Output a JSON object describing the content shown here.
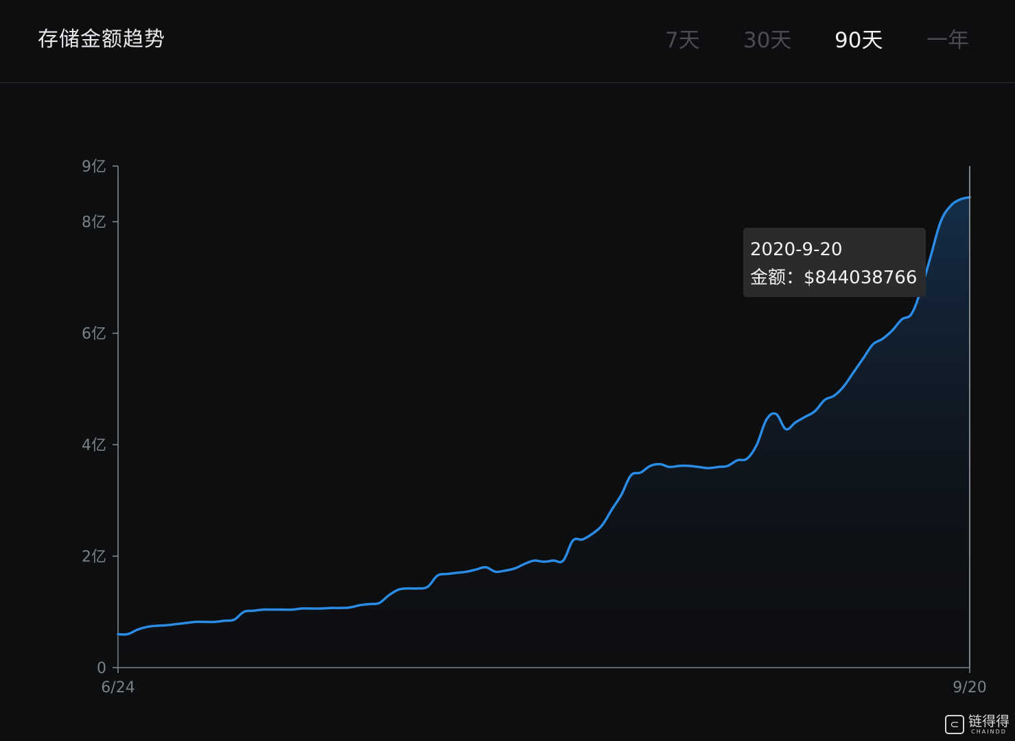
{
  "header": {
    "title": "存储金额趋势",
    "tabs": [
      {
        "label": "7天",
        "active": false
      },
      {
        "label": "30天",
        "active": false
      },
      {
        "label": "90天",
        "active": true
      },
      {
        "label": "一年",
        "active": false
      }
    ]
  },
  "tooltip": {
    "date": "2020-9-20",
    "amount_label": "金额：$844038766"
  },
  "watermark": {
    "logo_glyph": "⊂",
    "cn": "链得得",
    "en": "CHAINDD"
  },
  "colors": {
    "line": "#2b8ce6",
    "area_top": "#163352",
    "background": "#0d0e10",
    "axis": "#8a8d93"
  },
  "chart_data": {
    "type": "area",
    "title": "存储金额趋势",
    "xlabel": "",
    "ylabel": "",
    "x_range": [
      "6/24",
      "9/20"
    ],
    "x_tick_labels": [
      "6/24",
      "9/20"
    ],
    "y_tick_labels": [
      "0",
      "2亿",
      "4亿",
      "6亿",
      "8亿",
      "9亿"
    ],
    "y_tick_values": [
      0,
      200000000,
      400000000,
      600000000,
      800000000,
      900000000
    ],
    "ylim": [
      0,
      900000000
    ],
    "grid": false,
    "legend": "none",
    "series": [
      {
        "x": [
          "6/24",
          "6/25",
          "6/26",
          "6/27",
          "6/28",
          "6/29",
          "6/30",
          "7/1",
          "7/2",
          "7/3",
          "7/4",
          "7/5",
          "7/6",
          "7/7",
          "7/8",
          "7/9",
          "7/10",
          "7/11",
          "7/12",
          "7/13",
          "7/14",
          "7/15",
          "7/16",
          "7/17",
          "7/18",
          "7/19",
          "7/20",
          "7/21",
          "7/22",
          "7/23",
          "7/24",
          "7/25",
          "7/26",
          "7/27",
          "7/28",
          "7/29",
          "7/30",
          "7/31",
          "8/1",
          "8/2",
          "8/3",
          "8/4",
          "8/5",
          "8/6",
          "8/7",
          "8/8",
          "8/9",
          "8/10",
          "8/11",
          "8/12",
          "8/13",
          "8/14",
          "8/15",
          "8/16",
          "8/17",
          "8/18",
          "8/19",
          "8/20",
          "8/21",
          "8/22",
          "8/23",
          "8/24",
          "8/25",
          "8/26",
          "8/27",
          "8/28",
          "8/29",
          "8/30",
          "8/31",
          "9/1",
          "9/2",
          "9/3",
          "9/4",
          "9/5",
          "9/6",
          "9/7",
          "9/8",
          "9/9",
          "9/10",
          "9/11",
          "9/12",
          "9/13",
          "9/14",
          "9/15",
          "9/16",
          "9/17",
          "9/18",
          "9/19",
          "9/20"
        ],
        "values": [
          60000000,
          60000000,
          68000000,
          73000000,
          75000000,
          76000000,
          78000000,
          80000000,
          82000000,
          82000000,
          82000000,
          84000000,
          86000000,
          100000000,
          102000000,
          104000000,
          104000000,
          104000000,
          104000000,
          106000000,
          106000000,
          106000000,
          107000000,
          107000000,
          108000000,
          112000000,
          114000000,
          116000000,
          130000000,
          140000000,
          142000000,
          142000000,
          145000000,
          165000000,
          168000000,
          170000000,
          172000000,
          176000000,
          180000000,
          172000000,
          174000000,
          178000000,
          186000000,
          192000000,
          190000000,
          192000000,
          192000000,
          228000000,
          230000000,
          240000000,
          255000000,
          283000000,
          310000000,
          345000000,
          350000000,
          362000000,
          365000000,
          360000000,
          362000000,
          362000000,
          360000000,
          358000000,
          360000000,
          362000000,
          372000000,
          375000000,
          400000000,
          445000000,
          455000000,
          428000000,
          440000000,
          450000000,
          460000000,
          480000000,
          488000000,
          505000000,
          530000000,
          555000000,
          580000000,
          590000000,
          605000000,
          625000000,
          635000000,
          680000000,
          740000000,
          800000000,
          828000000,
          840000000,
          844038766
        ]
      }
    ]
  }
}
